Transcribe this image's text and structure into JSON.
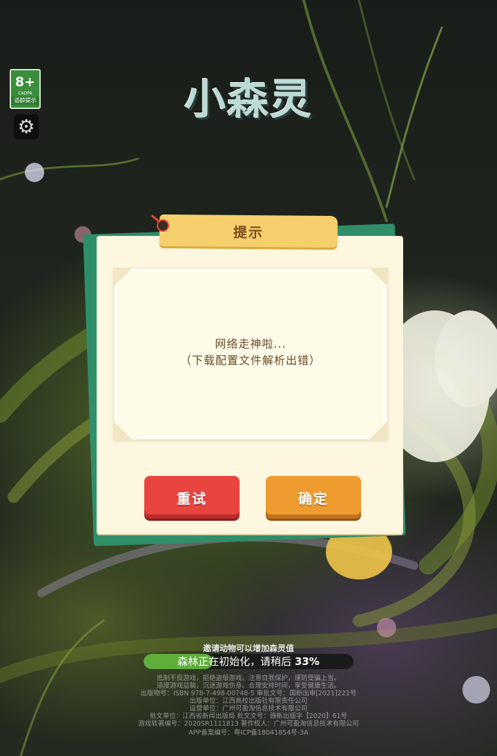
{
  "age_rating": {
    "value": "8+",
    "org": "CADPA",
    "label": "适龄提示"
  },
  "settings": {
    "icon": "gear-icon"
  },
  "logo": {
    "text": "小森灵"
  },
  "dialog": {
    "title": "提示",
    "message_line1": "网络走神啦...",
    "message_line2": "（下载配置文件解析出错）",
    "retry_label": "重试",
    "confirm_label": "确定"
  },
  "loading": {
    "invite_text": "邀请动物可以增加森灵值",
    "status_text": "森林正在初始化，请稍后",
    "percent": 33,
    "percent_text": "33%"
  },
  "legal_lines": [
    "抵制不良游戏，拒绝盗版游戏。注意自我保护，谨防受骗上当。",
    "适度游戏益脑，沉迷游戏伤身。合理安排时间，享受健康生活。",
    "出版物号：ISBN 978-7-498-00748-5  审批文号：国新出审[2021]221号",
    "出版单位：江西高校出版社有限责任公司",
    "运营单位：广州可盈淘信息技术有限公司",
    "批文单位：江西省新闻出版局  批文文号：赣新出版字【2020】61号",
    "游戏软著编号：2020SR1111813  著作权人：广州可盈淘信息技术有限公司",
    "APP备案编号：粤ICP备18041854号-3A"
  ],
  "colors": {
    "dialog_bg": "#fdf7df",
    "retry_button": "#e9443f",
    "confirm_button": "#ee9b2f",
    "progress_fill": "#5fae3c",
    "title_banner": "#f5cf6b"
  }
}
